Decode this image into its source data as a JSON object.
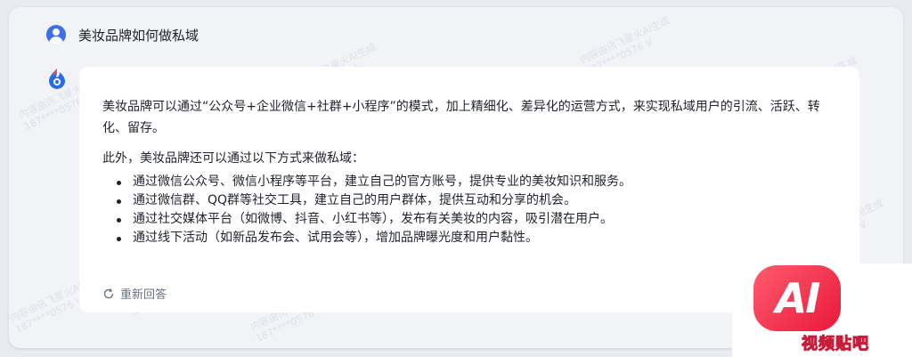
{
  "user": {
    "question": "美妆品牌如何做私域"
  },
  "answer": {
    "paragraph1": "美妆品牌可以通过“公众号+企业微信+社群+小程序”的模式，加上精细化、差异化的运营方式，来实现私域用户的引流、活跃、转化、留存。",
    "paragraph2": "此外，美妆品牌还可以通过以下方式来做私域：",
    "bullets": [
      "通过微信公众号、微信小程序等平台，建立自己的官方账号，提供专业的美妆知识和服务。",
      "通过微信群、QQ群等社交工具，建立自己的用户群体，提供互动和分享的机会。",
      "通过社交媒体平台（如微博、抖音、小红书等），发布有关美妆的内容，吸引潜在用户。",
      "通过线下活动（如新品发布会、试用会等），增加品牌曝光度和用户黏性。"
    ]
  },
  "footer": {
    "regenerate_label": "重新回答",
    "icons": [
      "refresh-icon",
      "play-icon",
      "share-icon",
      "copy-icon"
    ]
  },
  "watermark": {
    "line1": "内容由讯飞星火AI生成",
    "line2": "187****0576 V"
  },
  "badge": {
    "logo_text": "AI",
    "label": "视频贴吧"
  },
  "colors": {
    "user_avatar": "#3f6fe6",
    "badge_red": "#e8193a",
    "page_bg": "#e9ebf0",
    "card_bg": "#ffffff"
  }
}
